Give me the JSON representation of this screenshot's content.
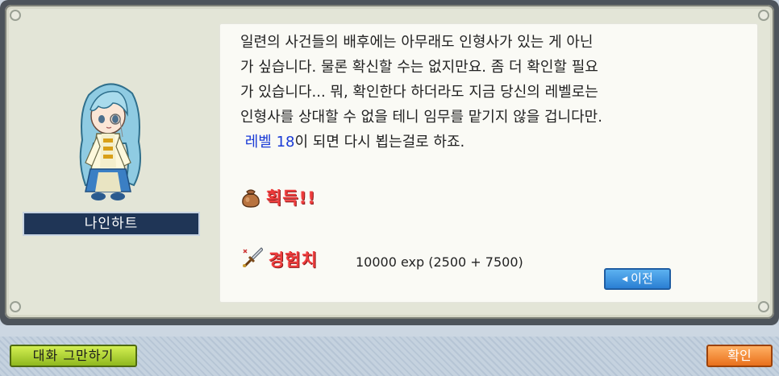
{
  "npc": {
    "name": "나인하트"
  },
  "dialog": {
    "lines": [
      "일련의 사건들의 배후에는 아무래도 인형사가 있는 게 아닌",
      "가 싶습니다. 물론 확신할 수는 없지만요. 좀 더 확인할 필요",
      "가 있습니다... 뭐, 확인한다 하더라도 지금 당신의 레벨로는",
      "인형사를 상대할 수 없을 테니 임무를 맡기지 않을 겁니다만."
    ],
    "level_requirement": "레벨 18",
    "line5_rest": "이 되면 다시 뵙는걸로 하죠."
  },
  "rewards": {
    "acquire_label": "획득!!",
    "exp_label": "경험치",
    "exp_value": "10000 exp (2500 + 7500)"
  },
  "buttons": {
    "prev_label": "이전",
    "end_chat_label": "대화 그만하기",
    "ok_label": "확인"
  },
  "colors": {
    "level_text": "#1a3bd6",
    "reward_label": "#ee3b3b",
    "prev_button": "#2a7fd3",
    "end_button": "#a6cc2a",
    "ok_button": "#f07f26",
    "name_plate": "#1f3556"
  },
  "icons": {
    "acquire": "sack-icon",
    "exp": "sword-icon"
  }
}
